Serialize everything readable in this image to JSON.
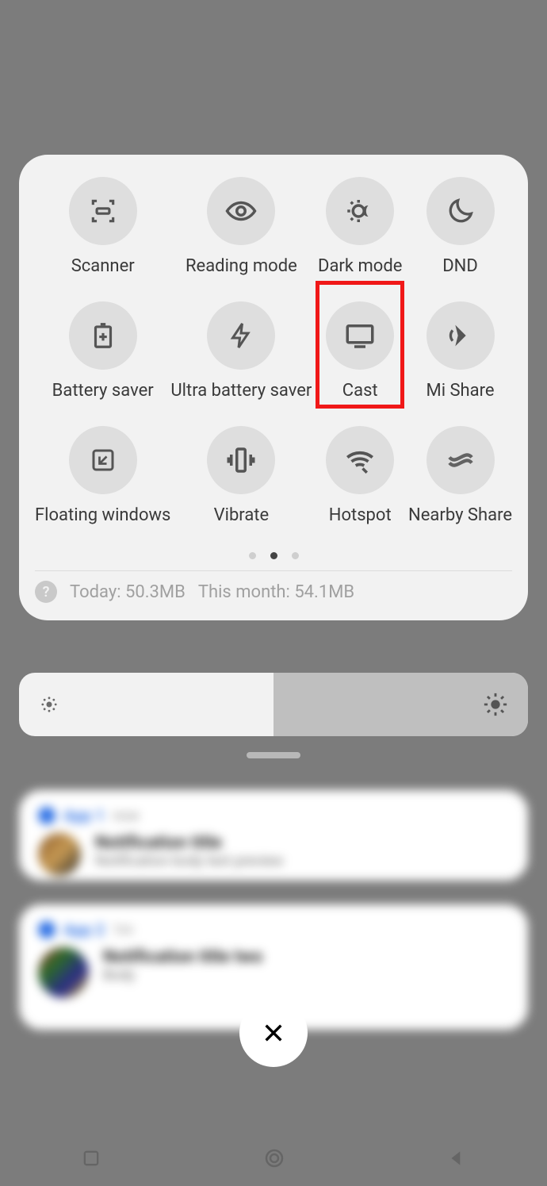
{
  "tiles": [
    [
      {
        "name": "scanner",
        "label": "Scanner",
        "icon": "scanner"
      },
      {
        "name": "reading-mode",
        "label": "Reading mode",
        "icon": "eye"
      },
      {
        "name": "dark-mode",
        "label": "Dark mode",
        "icon": "sun-moon"
      },
      {
        "name": "dnd",
        "label": "DND",
        "icon": "moon"
      }
    ],
    [
      {
        "name": "battery-saver",
        "label": "Battery saver",
        "icon": "battery-plus"
      },
      {
        "name": "ultra-battery-saver",
        "label": "Ultra battery saver",
        "icon": "bolt"
      },
      {
        "name": "cast",
        "label": "Cast",
        "icon": "cast",
        "highlighted": true
      },
      {
        "name": "mi-share",
        "label": "Mi Share",
        "icon": "mishare"
      }
    ],
    [
      {
        "name": "floating-windows",
        "label": "Floating windows",
        "icon": "floating"
      },
      {
        "name": "vibrate",
        "label": "Vibrate",
        "icon": "vibrate"
      },
      {
        "name": "hotspot",
        "label": "Hotspot",
        "icon": "hotspot"
      },
      {
        "name": "nearby-share",
        "label": "Nearby Share",
        "icon": "nearby"
      }
    ]
  ],
  "pager": {
    "total": 3,
    "active_index": 1
  },
  "data_usage": {
    "today_label": "Today: 50.3MB",
    "month_label": "This month: 54.1MB"
  },
  "brightness": {
    "level_percent": 50
  },
  "notifications": [
    {
      "app": "App 1",
      "time": "now",
      "title": "Notification title",
      "body": "Notification body text preview"
    },
    {
      "app": "App 2",
      "time": "1m",
      "title": "Notification title two",
      "body": "Body"
    }
  ],
  "close_label": "Clear all"
}
